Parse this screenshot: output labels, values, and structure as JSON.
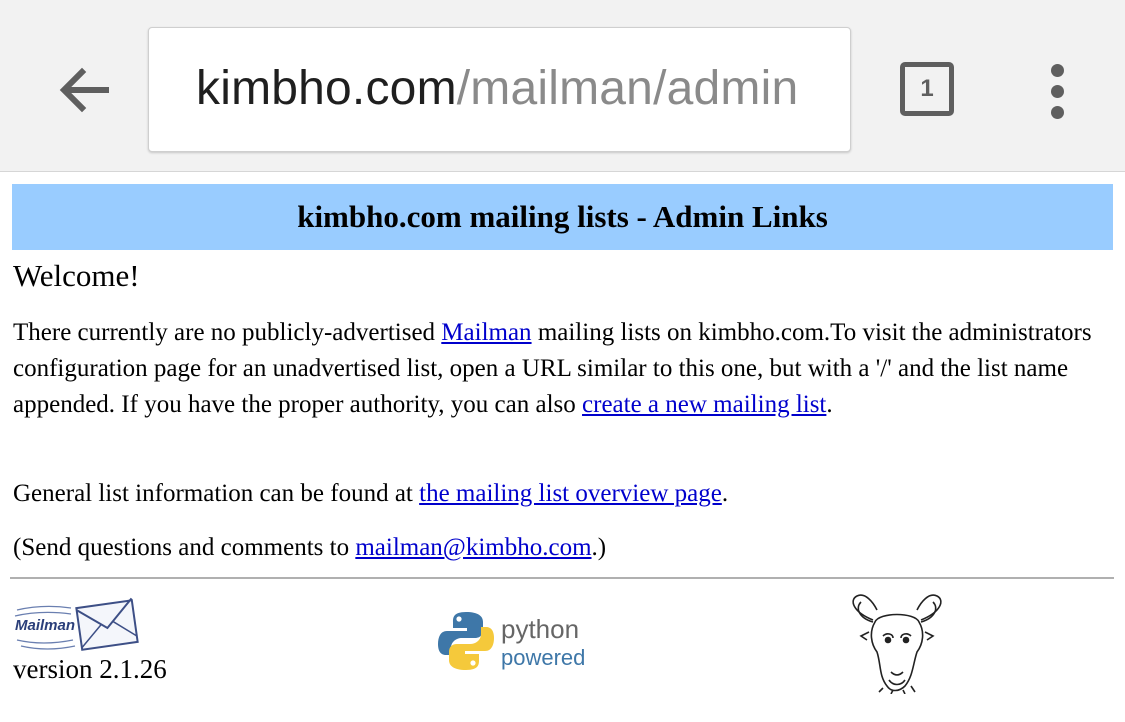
{
  "browser": {
    "url_host": "kimbho.com",
    "url_path": "/mailman/admin",
    "tab_count": "1",
    "icons": {
      "back": "back-arrow-icon",
      "tabs": "tab-switcher-icon",
      "menu": "overflow-menu-icon"
    }
  },
  "page": {
    "banner_title": "kimbho.com mailing lists - Admin Links",
    "welcome": "Welcome!",
    "p1": {
      "before_link": "There currently are no publicly-advertised ",
      "mailman_link": "Mailman",
      "middle": " mailing lists on kimbho.com.To visit the administrators configuration page for an unadvertised list, open a URL similar to this one, but with a '/' and the list name appended. If you have the proper authority, you can also ",
      "create_link": "create a new mailing list",
      "after": "."
    },
    "p2": {
      "before_link": "General list information can be found at ",
      "overview_link": "the mailing list overview page",
      "after": "."
    },
    "p3": {
      "before_link": "(Send questions and comments to ",
      "email_link": "mailman@kimbho.com",
      "after": ".)"
    },
    "footer": {
      "mailman_logo_text": "Mailman",
      "version": "version 2.1.26",
      "python_line1": "python",
      "python_line2": "powered"
    }
  },
  "colors": {
    "banner_bg": "#99ccff",
    "link": "#0000cc",
    "toolbar_bg": "#f2f2f2",
    "url_path": "#8a8a8a"
  }
}
